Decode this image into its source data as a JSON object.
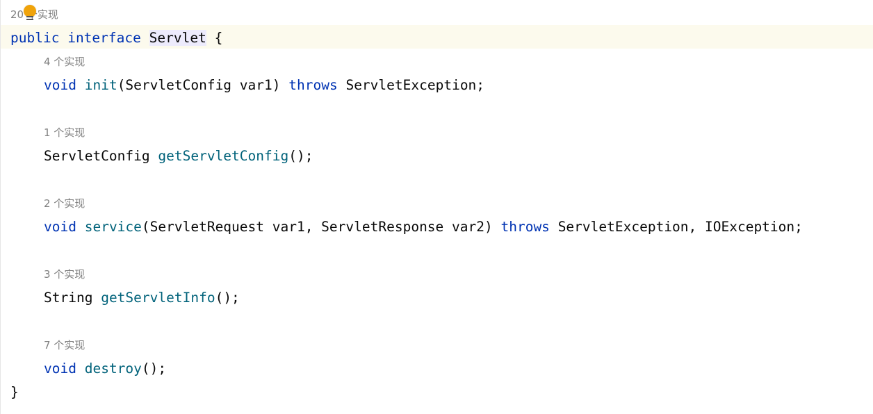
{
  "hints": {
    "interface": "20 个实现",
    "init": "4 个实现",
    "getServletConfig": "1 个实现",
    "service": "2 个实现",
    "getServletInfo": "3 个实现",
    "destroy": "7 个实现"
  },
  "code": {
    "line1": {
      "kw1": "public",
      "kw2": "interface",
      "name": "Servlet",
      "brace": "{"
    },
    "line_init": {
      "ret": "void",
      "name": "init",
      "params": "(ServletConfig var1)",
      "throws": "throws",
      "exc": "ServletException;"
    },
    "line_getConfig": {
      "ret": "ServletConfig",
      "name": "getServletConfig",
      "rest": "();"
    },
    "line_service": {
      "ret": "void",
      "name": "service",
      "params": "(ServletRequest var1, ServletResponse var2)",
      "throws": "throws",
      "exc": "ServletException, IOException;"
    },
    "line_getInfo": {
      "ret": "String",
      "name": "getServletInfo",
      "rest": "();"
    },
    "line_destroy": {
      "ret": "void",
      "name": "destroy",
      "rest": "();"
    },
    "closing_brace": "}"
  },
  "colors": {
    "keyword": "#0033b3",
    "method": "#00627a",
    "hint": "#808080",
    "gutter_marker": "#f0a30a"
  },
  "icons": {
    "gutter_marker": "implemented-marker-icon"
  }
}
